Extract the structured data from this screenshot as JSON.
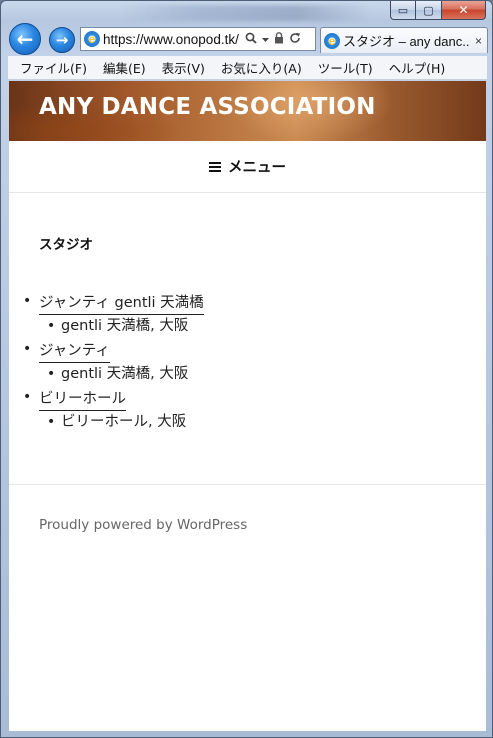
{
  "window": {
    "controls": {
      "minimize": "▭",
      "maximize": "▢",
      "close": "✕"
    }
  },
  "nav": {
    "back_icon": "←",
    "forward_icon": "→",
    "address_url": "https://www.onopod.tk/",
    "tab_title": "スタジオ – any danc...",
    "tab_close": "×"
  },
  "menubar": [
    "ファイル(F)",
    "編集(E)",
    "表示(V)",
    "お気に入り(A)",
    "ツール(T)",
    "ヘルプ(H)"
  ],
  "site": {
    "title": "ANY DANCE ASSOCIATION",
    "menu_label": "メニュー",
    "page_heading": "スタジオ",
    "studios": [
      {
        "name": "ジャンティ gentli 天満橋",
        "location": "gentli 天満橋, 大阪"
      },
      {
        "name": "ジャンティ",
        "location": "gentli 天満橋, 大阪"
      },
      {
        "name": "ビリーホール",
        "location": "ビリーホール, 大阪"
      }
    ],
    "footer_text": "Proudly powered by WordPress"
  },
  "colors": {
    "header_gradient_mid": "#b9753f",
    "frame": "#b6c8e0",
    "close_button": "#c8442c",
    "ie_blue": "#2a86e0"
  }
}
